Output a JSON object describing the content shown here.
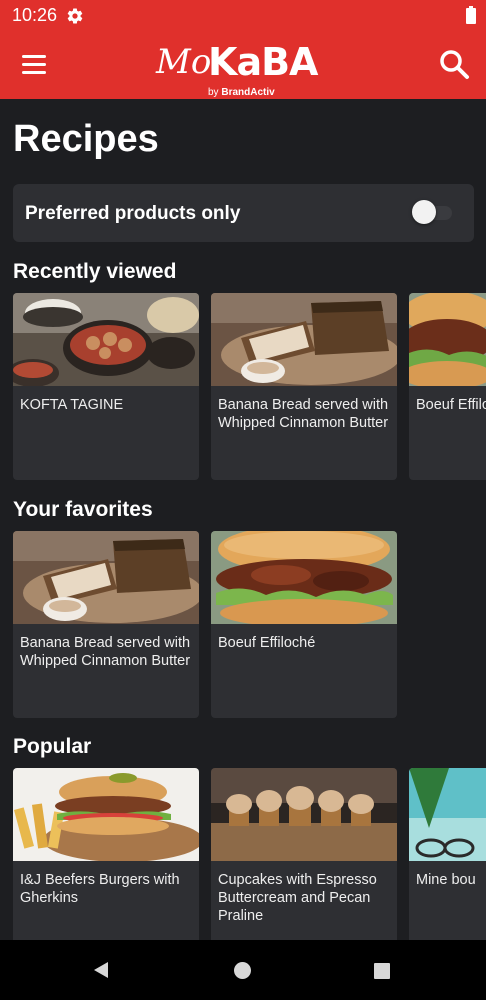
{
  "status": {
    "time": "10:26",
    "icons": [
      "gear-icon",
      "battery-icon"
    ]
  },
  "app": {
    "logo_script": "Mo",
    "logo_main": "KaBA",
    "logo_by": "by",
    "logo_brand": "BrandActiv",
    "brand_color": "#e0302c"
  },
  "page": {
    "title": "Recipes"
  },
  "filter": {
    "label": "Preferred products only",
    "enabled": false
  },
  "sections": {
    "recent": {
      "title": "Recently viewed",
      "items": [
        {
          "title": "KOFTA TAGINE"
        },
        {
          "title": "Banana Bread served with Whipped Cinnamon Butter"
        },
        {
          "title": "Boeuf Effiloché"
        }
      ]
    },
    "favorites": {
      "title": "Your favorites",
      "items": [
        {
          "title": "Banana Bread served with Whipped Cinnamon Butter"
        },
        {
          "title": "Boeuf Effiloché"
        }
      ]
    },
    "popular": {
      "title": "Popular",
      "items": [
        {
          "title": "I&J Beefers Burgers with Gherkins"
        },
        {
          "title": "Cupcakes with Espresso Buttercream and Pecan Praline"
        },
        {
          "title": "Mine bou"
        }
      ]
    }
  },
  "navigation": {
    "icons": [
      "back-icon",
      "home-icon",
      "recents-icon"
    ]
  }
}
